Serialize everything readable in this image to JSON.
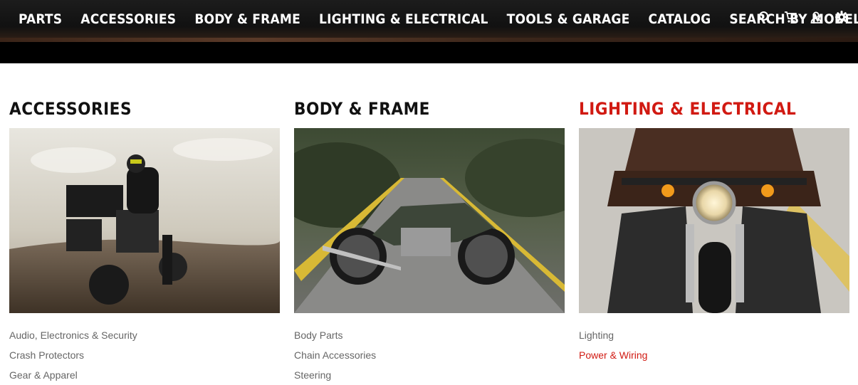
{
  "nav": {
    "items": [
      "PARTS",
      "ACCESSORIES",
      "BODY & FRAME",
      "LIGHTING & ELECTRICAL",
      "TOOLS & GARAGE",
      "CATALOG",
      "SEARCH BY MODEL"
    ],
    "icons": [
      "search-icon",
      "cart-icon",
      "user-icon",
      "gear-icon"
    ]
  },
  "categories": [
    {
      "title": "ACCESSORIES",
      "links": [
        "Audio, Electronics & Security",
        "Crash Protectors",
        "Gear & Apparel"
      ]
    },
    {
      "title": "BODY & FRAME",
      "links": [
        "Body Parts",
        "Chain Accessories",
        "Steering"
      ]
    },
    {
      "title": "LIGHTING & ELECTRICAL",
      "links": [
        "Lighting",
        "Power & Wiring"
      ]
    }
  ],
  "colors": {
    "accent": "#d11a12",
    "nav_bg": "#111111"
  }
}
